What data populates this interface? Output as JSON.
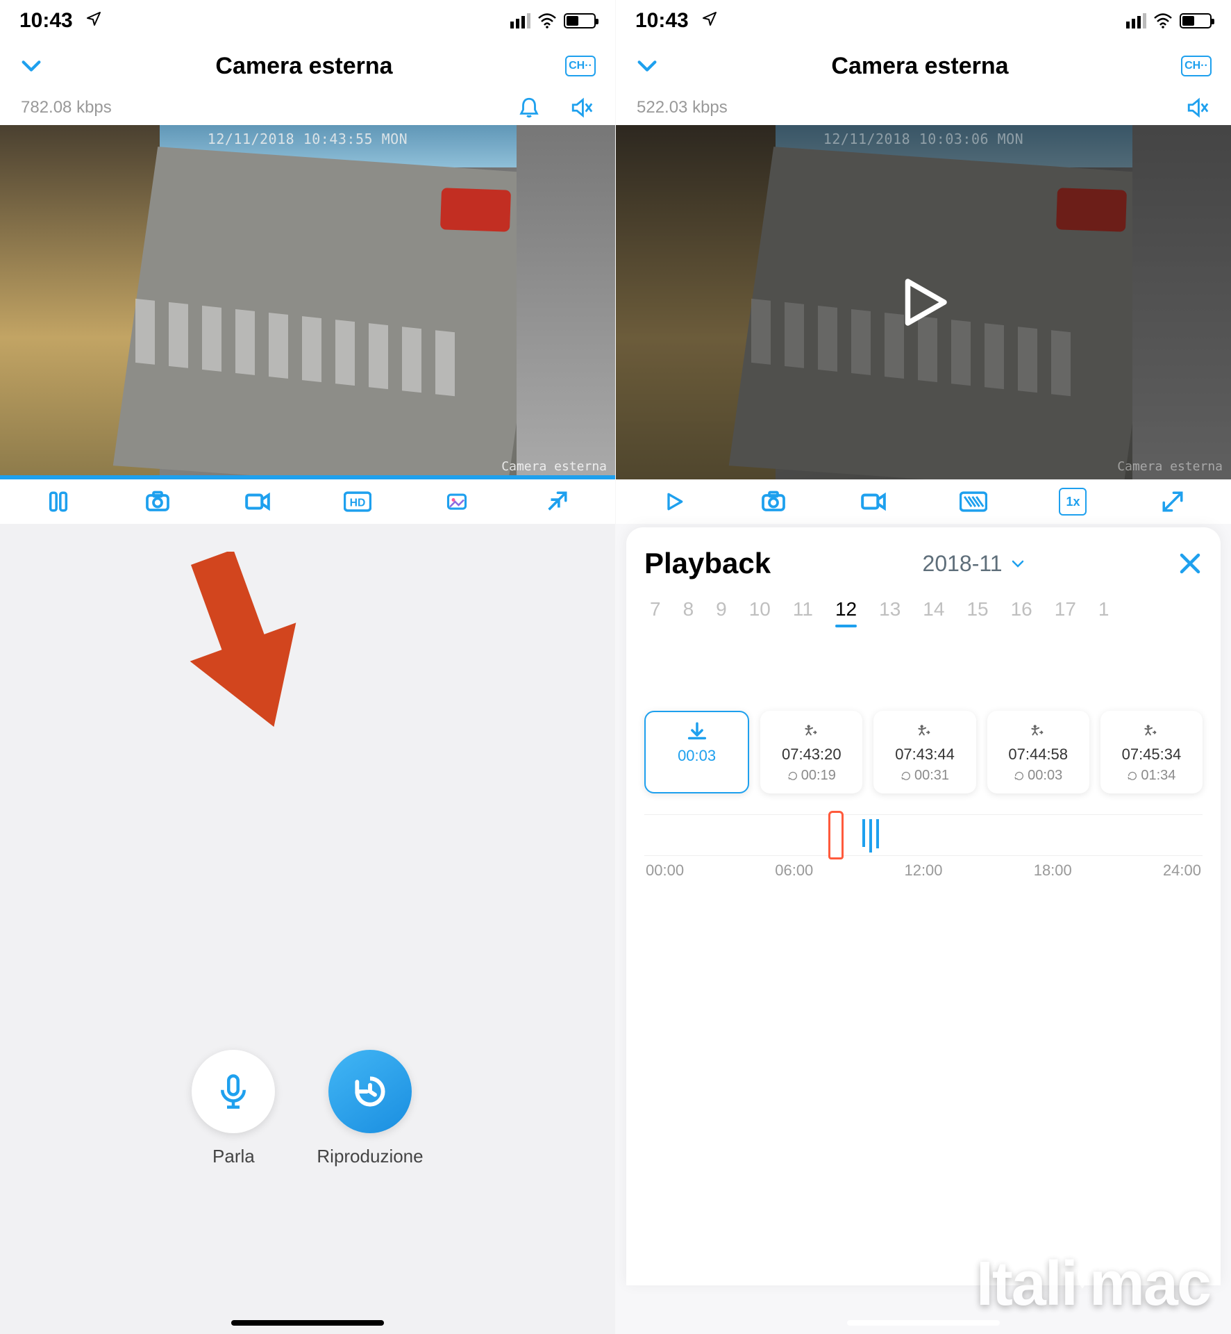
{
  "status": {
    "time": "10:43"
  },
  "left": {
    "title": "Camera esterna",
    "bitrate": "782.08 kbps",
    "timestamp": "12/11/2018 10:43:55 MON",
    "camera_label": "Camera esterna",
    "buttons": {
      "talk": "Parla",
      "playback": "Riproduzione"
    }
  },
  "right": {
    "title": "Camera esterna",
    "bitrate": "522.03 kbps",
    "timestamp": "12/11/2018 10:03:06 MON",
    "camera_label": "Camera esterna",
    "playback": {
      "title": "Playback",
      "month": "2018-11",
      "days": [
        "7",
        "8",
        "9",
        "10",
        "11",
        "12",
        "13",
        "14",
        "15",
        "16",
        "17",
        "1"
      ],
      "selected_day": "12",
      "download_time": "00:03",
      "clips": [
        {
          "time": "07:43:20",
          "dur": "00:19"
        },
        {
          "time": "07:43:44",
          "dur": "00:31"
        },
        {
          "time": "07:44:58",
          "dur": "00:03"
        },
        {
          "time": "07:45:34",
          "dur": "01:34"
        }
      ],
      "timeline_labels": [
        "00:00",
        "06:00",
        "12:00",
        "18:00",
        "24:00"
      ]
    }
  },
  "watermark": "Italiamac",
  "icons": {
    "ch": "CH··",
    "hd": "HD",
    "oneX": "1x"
  }
}
